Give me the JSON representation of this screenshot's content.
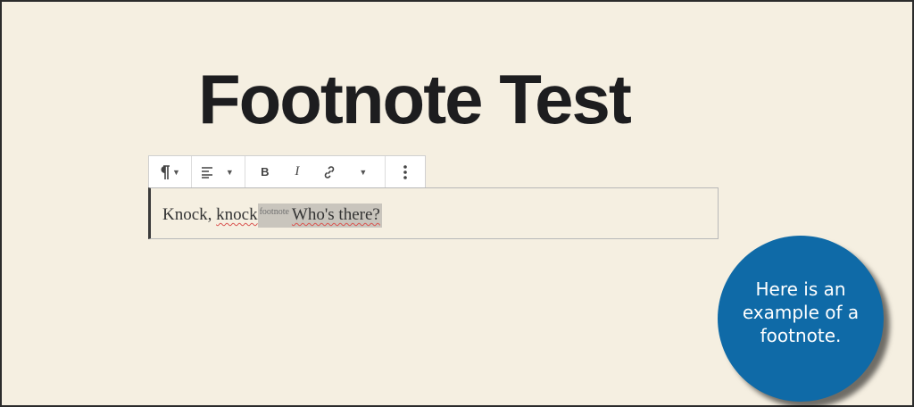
{
  "title": "Footnote Test",
  "toolbar": {
    "paragraph_icon": "pilcrow-icon",
    "align_icon": "align-left-icon",
    "bold_label": "B",
    "italic_label": "I",
    "link_icon": "link-icon",
    "more_icon": "vertical-ellipsis-icon"
  },
  "editor": {
    "text_before": "Knock, knock",
    "footnote_label": "footnote",
    "text_after": "Who's there?"
  },
  "bubble": {
    "text": "Here is an example of a footnote."
  },
  "colors": {
    "background": "#f5efe1",
    "title": "#1d1d1f",
    "bubble": "#0f6aa7",
    "highlight": "#c9c5bd"
  }
}
